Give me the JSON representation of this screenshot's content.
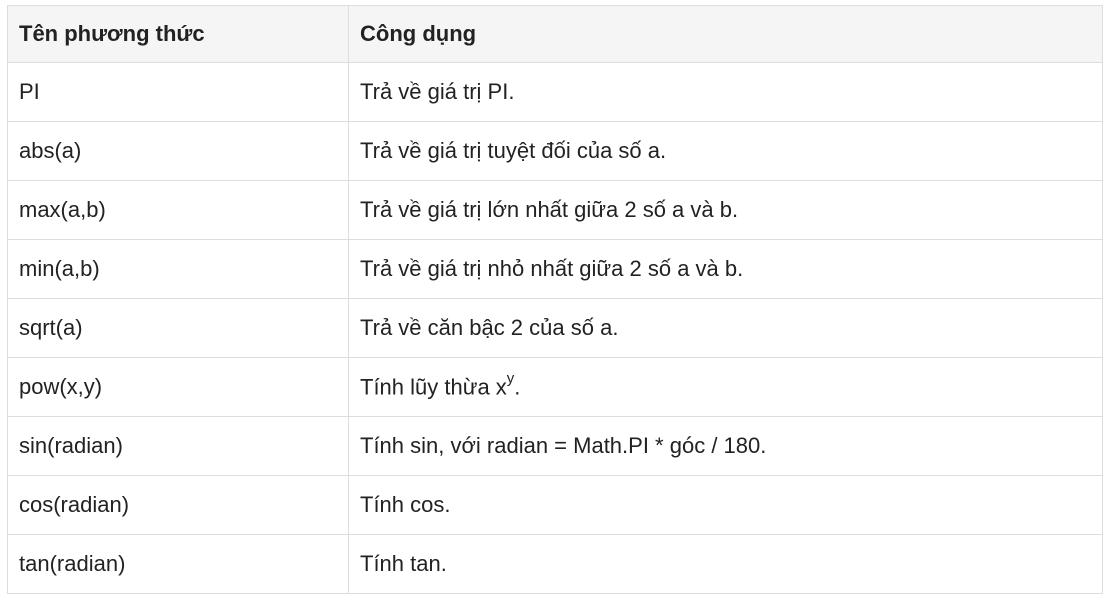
{
  "table": {
    "headers": [
      "Tên phương thức",
      "Công dụng"
    ],
    "rows": [
      {
        "method": "PI",
        "desc": "Trả về giá trị PI."
      },
      {
        "method": "abs(a)",
        "desc": "Trả về giá trị tuyệt đối của số a."
      },
      {
        "method": "max(a,b)",
        "desc": "Trả về giá trị lớn nhất giữa 2 số a và b."
      },
      {
        "method": "min(a,b)",
        "desc": "Trả về giá trị nhỏ nhất giữa 2 số a và b."
      },
      {
        "method": "sqrt(a)",
        "desc": "Trả về căn bậc 2 của số a."
      },
      {
        "method": "pow(x,y)",
        "desc_pre": "Tính lũy thừa x",
        "desc_sup": "y",
        "desc_post": "."
      },
      {
        "method": "sin(radian)",
        "desc": "Tính sin, với radian = Math.PI * góc / 180."
      },
      {
        "method": "cos(radian)",
        "desc": "Tính cos."
      },
      {
        "method": "tan(radian)",
        "desc": "Tính tan."
      }
    ]
  }
}
